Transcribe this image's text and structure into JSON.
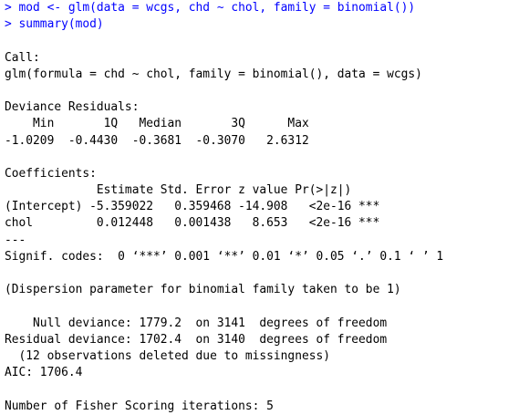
{
  "console": {
    "commands": [
      "> mod <- glm(data = wcgs, chd ~ chol, family = binomial())",
      "> summary(mod)"
    ],
    "call_header": "Call:",
    "call_line": "glm(formula = chd ~ chol, family = binomial(), data = wcgs)",
    "deviance_header": "Deviance Residuals:",
    "deviance_cols": "    Min       1Q   Median       3Q      Max  ",
    "deviance_vals": "-1.0209  -0.4430  -0.3681  -0.3070   2.6312  ",
    "coef_header": "Coefficients:",
    "coef_cols": "             Estimate Std. Error z value Pr(>|z|)    ",
    "coef_rows": [
      "(Intercept) -5.359022   0.359468 -14.908   <2e-16 ***",
      "chol         0.012448   0.001438   8.653   <2e-16 ***"
    ],
    "coef_sep": "---",
    "signif": "Signif. codes:  0 ‘***’ 0.001 ‘**’ 0.01 ‘*’ 0.05 ‘.’ 0.1 ‘ ’ 1",
    "dispersion": "(Dispersion parameter for binomial family taken to be 1)",
    "null_dev": "    Null deviance: 1779.2  on 3141  degrees of freedom",
    "resid_dev": "Residual deviance: 1702.4  on 3140  degrees of freedom",
    "missing": "  (12 observations deleted due to missingness)",
    "aic": "AIC: 1706.4",
    "fisher": "Number of Fisher Scoring iterations: 5"
  }
}
